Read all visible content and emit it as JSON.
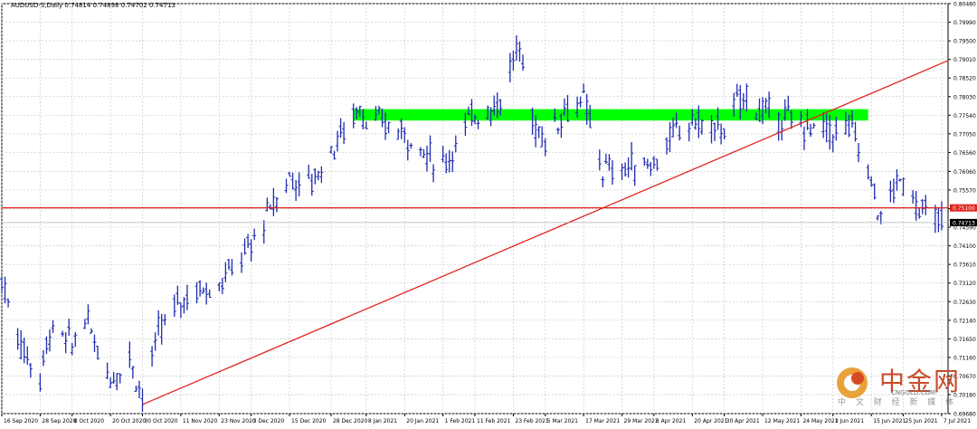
{
  "window": {
    "title": "AUDUSD-S,Daily  0.74814 0.74898 0.74702 0.74713"
  },
  "chart_data": {
    "type": "bar",
    "symbol": "AUDUSD-S",
    "timeframe": "Daily",
    "ohlc_header": {
      "open": 0.74814,
      "high": 0.74898,
      "low": 0.74702,
      "close": 0.74713
    },
    "ylim": [
      0.6968,
      0.8048
    ],
    "y_ticks": [
      "0.80480",
      "0.79990",
      "0.79500",
      "0.79010",
      "0.78520",
      "0.78030",
      "0.77540",
      "0.77050",
      "0.76560",
      "0.76060",
      "0.75570",
      "0.75080",
      "0.74590",
      "0.74100",
      "0.73610",
      "0.73120",
      "0.72630",
      "0.72140",
      "0.71650",
      "0.71160",
      "0.70670",
      "0.70180",
      "0.69680"
    ],
    "x_ticks": [
      "16 Sep 2020",
      "28 Sep 2020",
      "8 Oct 2020",
      "20 Oct 2020",
      "30 Oct 2020",
      "11 Nov 2020",
      "23 Nov 2020",
      "3 Dec 2020",
      "15 Dec 2020",
      "28 Dec 2020",
      "8 Jan 2021",
      "20 Jan 2021",
      "1 Feb 2021",
      "11 Feb 2021",
      "23 Feb 2021",
      "5 Mar 2021",
      "17 Mar 2021",
      "29 Mar 2021",
      "8 Apr 2021",
      "20 Apr 2021",
      "30 Apr 2021",
      "12 May 2021",
      "24 May 2021",
      "3 Jun 2021",
      "15 Jun 2021",
      "25 Jun 2021",
      "7 Jul 2021"
    ],
    "price_path": [
      {
        "date": "16 Sep 2020",
        "value": 0.732
      },
      {
        "date": "22 Sep 2020",
        "value": 0.715
      },
      {
        "date": "28 Sep 2020",
        "value": 0.706
      },
      {
        "date": "1 Oct 2020",
        "value": 0.719
      },
      {
        "date": "8 Oct 2020",
        "value": 0.715
      },
      {
        "date": "12 Oct 2020",
        "value": 0.722
      },
      {
        "date": "20 Oct 2020",
        "value": 0.706
      },
      {
        "date": "26 Oct 2020",
        "value": 0.712
      },
      {
        "date": "30 Oct 2020",
        "value": 0.701
      },
      {
        "date": "4 Nov 2020",
        "value": 0.718
      },
      {
        "date": "11 Nov 2020",
        "value": 0.727
      },
      {
        "date": "18 Nov 2020",
        "value": 0.73
      },
      {
        "date": "23 Nov 2020",
        "value": 0.731
      },
      {
        "date": "3 Dec 2020",
        "value": 0.741
      },
      {
        "date": "10 Dec 2020",
        "value": 0.752
      },
      {
        "date": "15 Dec 2020",
        "value": 0.759
      },
      {
        "date": "21 Dec 2020",
        "value": 0.757
      },
      {
        "date": "28 Dec 2020",
        "value": 0.766
      },
      {
        "date": "6 Jan 2021",
        "value": 0.778
      },
      {
        "date": "8 Jan 2021",
        "value": 0.774
      },
      {
        "date": "13 Jan 2021",
        "value": 0.773
      },
      {
        "date": "20 Jan 2021",
        "value": 0.771
      },
      {
        "date": "27 Jan 2021",
        "value": 0.765
      },
      {
        "date": "1 Feb 2021",
        "value": 0.762
      },
      {
        "date": "8 Feb 2021",
        "value": 0.772
      },
      {
        "date": "11 Feb 2021",
        "value": 0.776
      },
      {
        "date": "18 Feb 2021",
        "value": 0.778
      },
      {
        "date": "23 Feb 2021",
        "value": 0.79
      },
      {
        "date": "25 Feb 2021",
        "value": 0.793
      },
      {
        "date": "1 Mar 2021",
        "value": 0.774
      },
      {
        "date": "5 Mar 2021",
        "value": 0.769
      },
      {
        "date": "11 Mar 2021",
        "value": 0.777
      },
      {
        "date": "17 Mar 2021",
        "value": 0.779
      },
      {
        "date": "23 Mar 2021",
        "value": 0.761
      },
      {
        "date": "29 Mar 2021",
        "value": 0.761
      },
      {
        "date": "1 Apr 2021",
        "value": 0.762
      },
      {
        "date": "8 Apr 2021",
        "value": 0.763
      },
      {
        "date": "14 Apr 2021",
        "value": 0.77
      },
      {
        "date": "20 Apr 2021",
        "value": 0.774
      },
      {
        "date": "26 Apr 2021",
        "value": 0.772
      },
      {
        "date": "30 Apr 2021",
        "value": 0.772
      },
      {
        "date": "6 May 2021",
        "value": 0.781
      },
      {
        "date": "12 May 2021",
        "value": 0.776
      },
      {
        "date": "18 May 2021",
        "value": 0.775
      },
      {
        "date": "24 May 2021",
        "value": 0.773
      },
      {
        "date": "28 May 2021",
        "value": 0.772
      },
      {
        "date": "3 Jun 2021",
        "value": 0.771
      },
      {
        "date": "9 Jun 2021",
        "value": 0.772
      },
      {
        "date": "15 Jun 2021",
        "value": 0.758
      },
      {
        "date": "18 Jun 2021",
        "value": 0.748
      },
      {
        "date": "22 Jun 2021",
        "value": 0.756
      },
      {
        "date": "25 Jun 2021",
        "value": 0.758
      },
      {
        "date": "1 Jul 2021",
        "value": 0.75
      },
      {
        "date": "7 Jul 2021",
        "value": 0.7471
      }
    ],
    "annotations": {
      "trendline": {
        "start": {
          "date": "30 Oct 2020",
          "value": 0.6992
        },
        "end": {
          "date": "9 Jul 2021",
          "value": 0.7898
        },
        "color": "#e0221c"
      },
      "horizontal_line": {
        "value": 0.751,
        "label": "0.75100",
        "color": "#e0221c"
      },
      "current_price": {
        "value": 0.74713,
        "label": "0.74713"
      },
      "resistance_zone": {
        "from_date": "4 Jan 2021",
        "to_date": "14 Jun 2021",
        "low": 0.774,
        "high": 0.777,
        "color": "#00ff00"
      }
    },
    "colors": {
      "bars": "#1f2bb0",
      "grid": "#c8c8c8",
      "axis_text": "#000000"
    }
  },
  "watermark": {
    "cn": "中金网",
    "sub": "中 文 财 经 新 媒 体",
    "url": "CNGOLD.COM"
  }
}
